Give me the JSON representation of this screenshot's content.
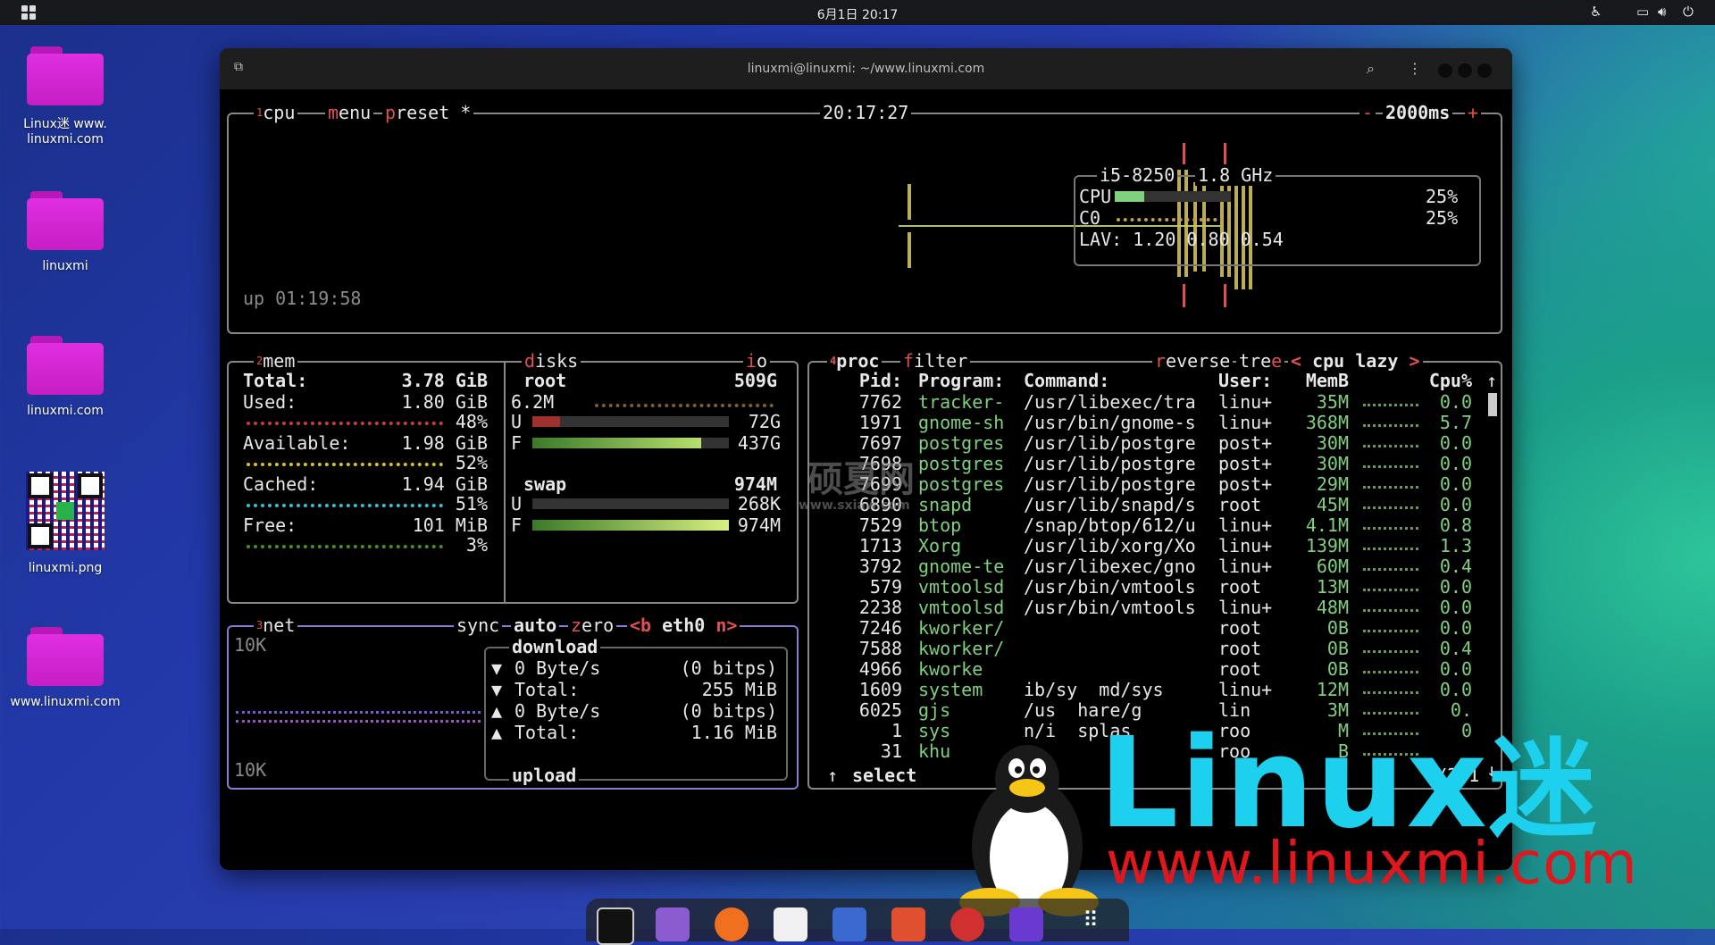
{
  "topbar": {
    "datetime": "6月1日  20:17"
  },
  "desktop": {
    "icons": [
      {
        "label": "Linux迷 www.\nlinuxmi.com"
      },
      {
        "label": "linuxmi"
      },
      {
        "label": "linuxmi.com"
      },
      {
        "label": "linuxmi.png"
      },
      {
        "label": "www.linuxmi.com"
      }
    ]
  },
  "window": {
    "title": "linuxmi@linuxmi: ~/www.linuxmi.com"
  },
  "cpu": {
    "num": "1",
    "label": "cpu",
    "menu": "menu",
    "preset": "preset *",
    "clock": "20:17:27",
    "interval": "2000ms",
    "minus": "-",
    "plus": "+",
    "uptime": "up 01:19:58",
    "model": "i5-8250",
    "freq": "1.8 GHz",
    "cpu_label": "CPU",
    "cpu_pct": "25%",
    "cpu_level": 0.25,
    "c0_label": "C0",
    "c0_pct": "25%",
    "lav": "LAV: 1.20 0.80 0.54"
  },
  "mem": {
    "num": "2",
    "label": "mem",
    "rows": [
      {
        "k": "Total:",
        "v": "3.78 GiB"
      },
      {
        "k": "Used:",
        "v": "1.80 GiB",
        "pct": "48%",
        "color": "#c04040"
      },
      {
        "k": "Available:",
        "v": "1.98 GiB",
        "pct": "52%",
        "color": "#d0c040"
      },
      {
        "k": "Cached:",
        "v": "1.94 GiB",
        "pct": "51%",
        "color": "#40b8d0"
      },
      {
        "k": "Free:",
        "v": "101 MiB",
        "pct": "3%",
        "color": "#60a040"
      }
    ]
  },
  "disks": {
    "label": "disks",
    "io": "io",
    "root_name": "root",
    "root_size": "509G",
    "root_io": "6.2M",
    "root_used": "72G",
    "root_free": "437G",
    "root_used_frac": 0.14,
    "root_free_frac": 0.86,
    "swap_name": "swap",
    "swap_size": "974M",
    "swap_used": "268K",
    "swap_free": "974M",
    "swap_used_frac": 0.0,
    "swap_free_frac": 1.0,
    "u": "U",
    "f": "F"
  },
  "net": {
    "num": "3",
    "label": "net",
    "sync": "sync",
    "auto": "auto",
    "zero": "zero",
    "iface": "<b eth0 n>",
    "scale_top": "10K",
    "scale_bottom": "10K",
    "download": "download",
    "upload": "upload",
    "rows": [
      {
        "arrow": "▼",
        "k": "0 Byte/s",
        "v": "(0 bitps)"
      },
      {
        "arrow": "▼",
        "k": "Total:",
        "v": "255 MiB"
      },
      {
        "arrow": "▲",
        "k": "0 Byte/s",
        "v": "(0 bitps)"
      },
      {
        "arrow": "▲",
        "k": "Total:",
        "v": "1.16 MiB"
      }
    ]
  },
  "proc": {
    "num": "4",
    "label": "proc",
    "filter": "filter",
    "reverse": "reverse",
    "tree": "tree",
    "sort": "< cpu lazy >",
    "headers": [
      "Pid:",
      "Program:",
      "Command:",
      "User:",
      "MemB",
      "Cpu%"
    ],
    "rows": [
      {
        "pid": "7762",
        "prog": "tracker-",
        "cmd": "/usr/libexec/tra",
        "user": "linu+",
        "mem": "35M",
        "cpu": "0.0"
      },
      {
        "pid": "1971",
        "prog": "gnome-sh",
        "cmd": "/usr/bin/gnome-s",
        "user": "linu+",
        "mem": "368M",
        "cpu": "5.7"
      },
      {
        "pid": "7697",
        "prog": "postgres",
        "cmd": "/usr/lib/postgre",
        "user": "post+",
        "mem": "30M",
        "cpu": "0.0"
      },
      {
        "pid": "7698",
        "prog": "postgres",
        "cmd": "/usr/lib/postgre",
        "user": "post+",
        "mem": "30M",
        "cpu": "0.0"
      },
      {
        "pid": "7699",
        "prog": "postgres",
        "cmd": "/usr/lib/postgre",
        "user": "post+",
        "mem": "29M",
        "cpu": "0.0"
      },
      {
        "pid": "6890",
        "prog": "snapd",
        "cmd": "/usr/lib/snapd/s",
        "user": "root",
        "mem": "45M",
        "cpu": "0.0"
      },
      {
        "pid": "7529",
        "prog": "btop",
        "cmd": "/snap/btop/612/u",
        "user": "linu+",
        "mem": "4.1M",
        "cpu": "0.8"
      },
      {
        "pid": "1713",
        "prog": "Xorg",
        "cmd": "/usr/lib/xorg/Xo",
        "user": "linu+",
        "mem": "139M",
        "cpu": "1.3"
      },
      {
        "pid": "3792",
        "prog": "gnome-te",
        "cmd": "/usr/libexec/gno",
        "user": "linu+",
        "mem": "60M",
        "cpu": "0.4"
      },
      {
        "pid": "579",
        "prog": "vmtoolsd",
        "cmd": "/usr/bin/vmtools",
        "user": "root",
        "mem": "13M",
        "cpu": "0.0"
      },
      {
        "pid": "2238",
        "prog": "vmtoolsd",
        "cmd": "/usr/bin/vmtools",
        "user": "linu+",
        "mem": "48M",
        "cpu": "0.0"
      },
      {
        "pid": "7246",
        "prog": "kworker/",
        "cmd": "",
        "user": "root",
        "mem": "0B",
        "cpu": "0.0"
      },
      {
        "pid": "7588",
        "prog": "kworker/",
        "cmd": "",
        "user": "root",
        "mem": "0B",
        "cpu": "0.4"
      },
      {
        "pid": "4966",
        "prog": "kworke",
        "cmd": "",
        "user": "root",
        "mem": "0B",
        "cpu": "0.0"
      },
      {
        "pid": "1609",
        "prog": "system",
        "cmd": "ib/sy  md/sys",
        "user": "linu+",
        "mem": "12M",
        "cpu": "0.0"
      },
      {
        "pid": "6025",
        "prog": "gjs",
        "cmd": "/us  hare/g",
        "user": "lin",
        "mem": "3M",
        "cpu": "0."
      },
      {
        "pid": "1",
        "prog": "sys",
        "cmd": "n/i  splas",
        "user": "roo",
        "mem": "M",
        "cpu": "0"
      },
      {
        "pid": "31",
        "prog": "khu",
        "cmd": "",
        "user": "roo",
        "mem": "B",
        "cpu": ""
      }
    ],
    "select": "select",
    "count": "0/231",
    "scroll_up": "↑",
    "scroll_down": "↓"
  },
  "overlay": {
    "logo": "Linux",
    "logo_mi": "迷",
    "url": "www.linuxmi.com",
    "watermark": "硕夏网",
    "watermark_url": "www.sxiaw.com"
  },
  "colors": {
    "accent_red": "#e05050",
    "border": "#888888",
    "logo_cyan": "#1dd0ee",
    "logo_red": "#e0181e"
  }
}
